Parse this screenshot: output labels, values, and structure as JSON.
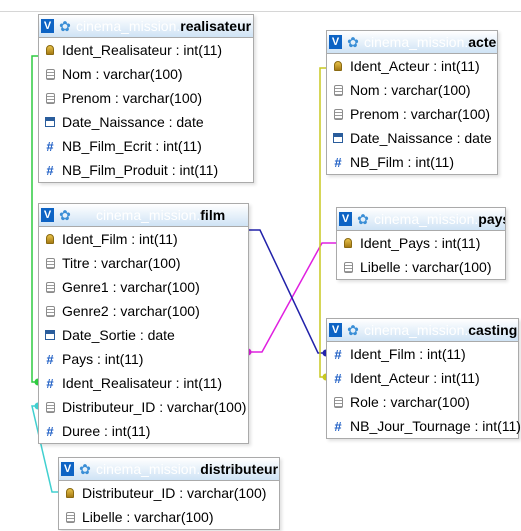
{
  "database": "cinema_mission",
  "separator": ".",
  "toggle_label": "V",
  "tables": [
    {
      "name": "realisateur",
      "columns": [
        {
          "text": "Ident_Realisateur : int(11)",
          "icon": "primary-key-icon"
        },
        {
          "text": "Nom : varchar(100)",
          "icon": "varchar-icon"
        },
        {
          "text": "Prenom : varchar(100)",
          "icon": "varchar-icon"
        },
        {
          "text": "Date_Naissance : date",
          "icon": "date-icon"
        },
        {
          "text": "NB_Film_Ecrit : int(11)",
          "icon": "numeric-icon"
        },
        {
          "text": "NB_Film_Produit : int(11)",
          "icon": "numeric-icon"
        }
      ]
    },
    {
      "name": "acteur",
      "columns": [
        {
          "text": "Ident_Acteur : int(11)",
          "icon": "primary-key-icon"
        },
        {
          "text": "Nom : varchar(100)",
          "icon": "varchar-icon"
        },
        {
          "text": "Prenom : varchar(100)",
          "icon": "varchar-icon"
        },
        {
          "text": "Date_Naissance : date",
          "icon": "date-icon"
        },
        {
          "text": "NB_Film : int(11)",
          "icon": "numeric-icon"
        }
      ]
    },
    {
      "name": "film",
      "columns": [
        {
          "text": "Ident_Film : int(11)",
          "icon": "primary-key-icon"
        },
        {
          "text": "Titre : varchar(100)",
          "icon": "varchar-icon"
        },
        {
          "text": "Genre1 : varchar(100)",
          "icon": "varchar-icon"
        },
        {
          "text": "Genre2 : varchar(100)",
          "icon": "varchar-icon"
        },
        {
          "text": "Date_Sortie : date",
          "icon": "date-icon"
        },
        {
          "text": "Pays : int(11)",
          "icon": "numeric-icon"
        },
        {
          "text": "Ident_Realisateur : int(11)",
          "icon": "numeric-icon"
        },
        {
          "text": "Distributeur_ID : varchar(100)",
          "icon": "varchar-icon"
        },
        {
          "text": "Duree : int(11)",
          "icon": "numeric-icon"
        }
      ]
    },
    {
      "name": "pays",
      "columns": [
        {
          "text": "Ident_Pays : int(11)",
          "icon": "primary-key-icon"
        },
        {
          "text": "Libelle : varchar(100)",
          "icon": "varchar-icon"
        }
      ]
    },
    {
      "name": "casting",
      "columns": [
        {
          "text": "Ident_Film : int(11)",
          "icon": "numeric-icon"
        },
        {
          "text": "Ident_Acteur : int(11)",
          "icon": "numeric-icon"
        },
        {
          "text": "Role : varchar(100)",
          "icon": "varchar-icon"
        },
        {
          "text": "NB_Jour_Tournage : int(11)",
          "icon": "numeric-icon"
        }
      ]
    },
    {
      "name": "distributeur",
      "columns": [
        {
          "text": "Distributeur_ID : varchar(100)",
          "icon": "primary-key-icon"
        },
        {
          "text": "Libelle : varchar(100)",
          "icon": "varchar-icon"
        }
      ]
    }
  ],
  "relations": [
    {
      "from": "film.Ident_Realisateur",
      "to": "realisateur.Ident_Realisateur",
      "color": "#2ecc40"
    },
    {
      "from": "film.Distributeur_ID",
      "to": "distributeur.Distributeur_ID",
      "color": "#40d0d0"
    },
    {
      "from": "film.Pays",
      "to": "pays.Ident_Pays",
      "color": "#e020e0"
    },
    {
      "from": "casting.Ident_Film",
      "to": "film.Ident_Film",
      "color": "#2222aa"
    },
    {
      "from": "casting.Ident_Acteur",
      "to": "acteur.Ident_Acteur",
      "color": "#c8c820"
    }
  ]
}
